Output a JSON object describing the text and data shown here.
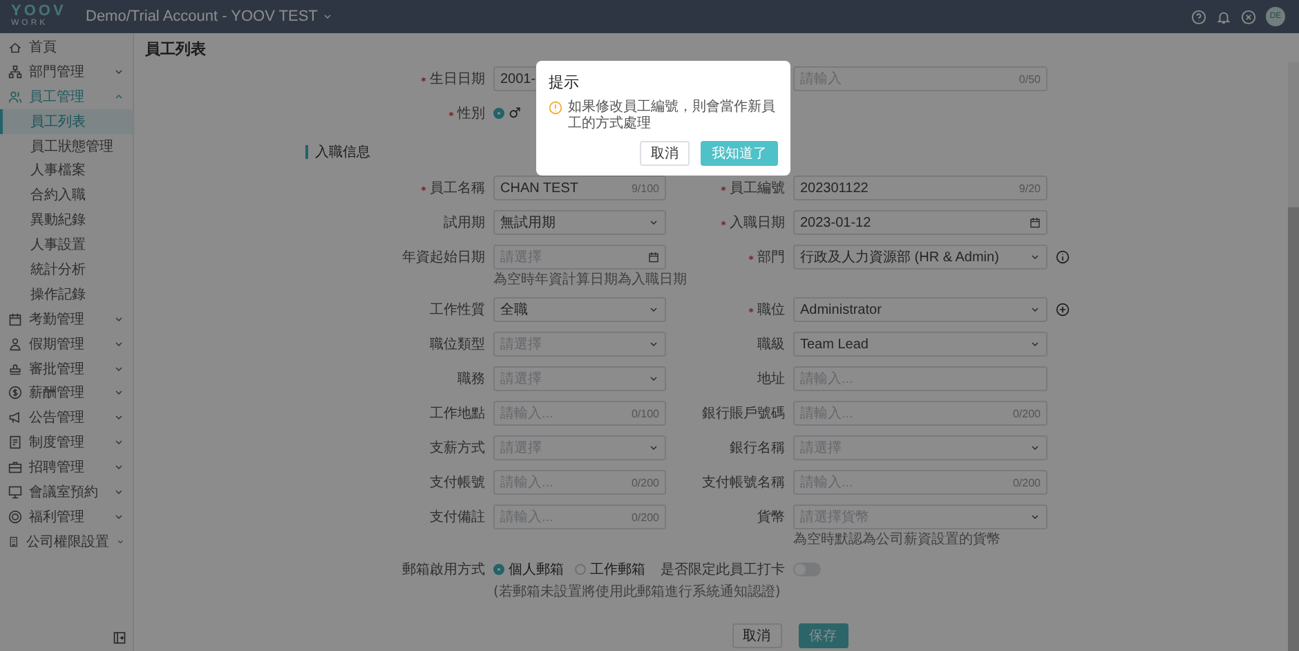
{
  "header": {
    "logo": "YOOV",
    "logo_sub": "WORK",
    "account": "Demo/Trial Account - YOOV TEST",
    "avatar": "DE"
  },
  "sidebar": {
    "items": [
      {
        "label": "首頁",
        "kind": "link"
      },
      {
        "label": "部門管理",
        "kind": "group",
        "expanded": false
      },
      {
        "label": "員工管理",
        "kind": "group",
        "expanded": true,
        "children": [
          {
            "label": "員工列表",
            "selected": true
          },
          {
            "label": "員工狀態管理",
            "selected": false
          },
          {
            "label": "人事檔案",
            "selected": false
          },
          {
            "label": "合約入職",
            "selected": false
          },
          {
            "label": "異動紀錄",
            "selected": false
          },
          {
            "label": "人事設置",
            "selected": false
          },
          {
            "label": "統計分析",
            "selected": false
          },
          {
            "label": "操作記錄",
            "selected": false
          }
        ]
      },
      {
        "label": "考勤管理",
        "kind": "group",
        "expanded": false
      },
      {
        "label": "假期管理",
        "kind": "group",
        "expanded": false
      },
      {
        "label": "審批管理",
        "kind": "group",
        "expanded": false
      },
      {
        "label": "薪酬管理",
        "kind": "group",
        "expanded": false
      },
      {
        "label": "公告管理",
        "kind": "group",
        "expanded": false
      },
      {
        "label": "制度管理",
        "kind": "group",
        "expanded": false
      },
      {
        "label": "招聘管理",
        "kind": "group",
        "expanded": false
      },
      {
        "label": "會議室預約",
        "kind": "group",
        "expanded": false
      },
      {
        "label": "福利管理",
        "kind": "group",
        "expanded": false
      },
      {
        "label": "公司權限設置",
        "kind": "group",
        "expanded": false
      }
    ]
  },
  "page_title": "員工列表",
  "form": {
    "top_rows": [
      [
        {
          "label": "生日日期",
          "required": true,
          "kind": "text",
          "value": "2001-"
        },
        {
          "kind": "text",
          "placeholder": "請輸入",
          "count": "0/50"
        }
      ],
      [
        {
          "label": "性別",
          "required": true,
          "kind": "radio",
          "options": [
            {
              "label": "♂",
              "selected": true
            }
          ]
        },
        {
          "kind": "empty"
        }
      ]
    ],
    "section": "入職信息",
    "rows": [
      [
        {
          "label": "員工名稱",
          "required": true,
          "kind": "text",
          "value": "CHAN TEST",
          "count": "9/100"
        },
        {
          "label": "員工編號",
          "required": true,
          "kind": "text",
          "value": "202301122",
          "count": "9/20"
        }
      ],
      [
        {
          "label": "試用期",
          "required": false,
          "kind": "select",
          "value": "無試用期"
        },
        {
          "label": "入職日期",
          "required": true,
          "kind": "date",
          "value": "2023-01-12"
        }
      ],
      [
        {
          "label": "年資起始日期",
          "required": false,
          "kind": "date",
          "placeholder": "請選擇",
          "hint": "為空時年資計算日期為入職日期"
        },
        {
          "label": "部門",
          "required": true,
          "kind": "select",
          "value": "行政及人力資源部 (HR & Admin)",
          "info_button": true
        }
      ],
      [
        {
          "label": "工作性質",
          "required": false,
          "kind": "select",
          "value": "全職"
        },
        {
          "label": "職位",
          "required": true,
          "kind": "select",
          "value": "Administrator",
          "add_button": true
        }
      ],
      [
        {
          "label": "職位類型",
          "required": false,
          "kind": "select",
          "placeholder": "請選擇"
        },
        {
          "label": "職級",
          "required": false,
          "kind": "select",
          "value": "Team Lead"
        }
      ],
      [
        {
          "label": "職務",
          "required": false,
          "kind": "select",
          "placeholder": "請選擇"
        },
        {
          "label": "地址",
          "required": false,
          "kind": "text",
          "placeholder": "請輸入..."
        }
      ],
      [
        {
          "label": "工作地點",
          "required": false,
          "kind": "text",
          "placeholder": "請輸入...",
          "count": "0/100"
        },
        {
          "label": "銀行賬戶號碼",
          "required": false,
          "kind": "text",
          "placeholder": "請輸入...",
          "count": "0/200"
        }
      ],
      [
        {
          "label": "支薪方式",
          "required": false,
          "kind": "select",
          "placeholder": "請選擇"
        },
        {
          "label": "銀行名稱",
          "required": false,
          "kind": "select",
          "placeholder": "請選擇"
        }
      ],
      [
        {
          "label": "支付帳號",
          "required": false,
          "kind": "text",
          "placeholder": "請輸入...",
          "count": "0/200"
        },
        {
          "label": "支付帳號名稱",
          "required": false,
          "kind": "text",
          "placeholder": "請輸入...",
          "count": "0/200"
        }
      ],
      [
        {
          "label": "支付備註",
          "required": false,
          "kind": "text",
          "placeholder": "請輸入...",
          "count": "0/200"
        },
        {
          "label": "貨幣",
          "required": false,
          "kind": "select",
          "placeholder": "請選擇貨幣",
          "hint": "為空時默認為公司薪資設置的貨幣"
        }
      ],
      [
        {
          "label": "郵箱啟用方式",
          "required": false,
          "kind": "radio",
          "options": [
            {
              "label": "個人郵箱",
              "selected": true
            },
            {
              "label": "工作郵箱",
              "selected": false
            }
          ],
          "hint": "(若郵箱未設置將使用此郵箱進行系統通知認證)"
        },
        {
          "label": "是否限定此員工打卡",
          "required": false,
          "kind": "toggle",
          "on": false
        }
      ]
    ],
    "buttons": [
      {
        "label": "取消",
        "kind": "default"
      },
      {
        "label": "保存",
        "kind": "primary"
      }
    ]
  },
  "dialog": {
    "title": "提示",
    "message": "如果修改員工編號，則會當作新員工的方式處理",
    "buttons": [
      {
        "label": "取消",
        "kind": "default"
      },
      {
        "label": "我知道了",
        "kind": "primary"
      }
    ]
  }
}
